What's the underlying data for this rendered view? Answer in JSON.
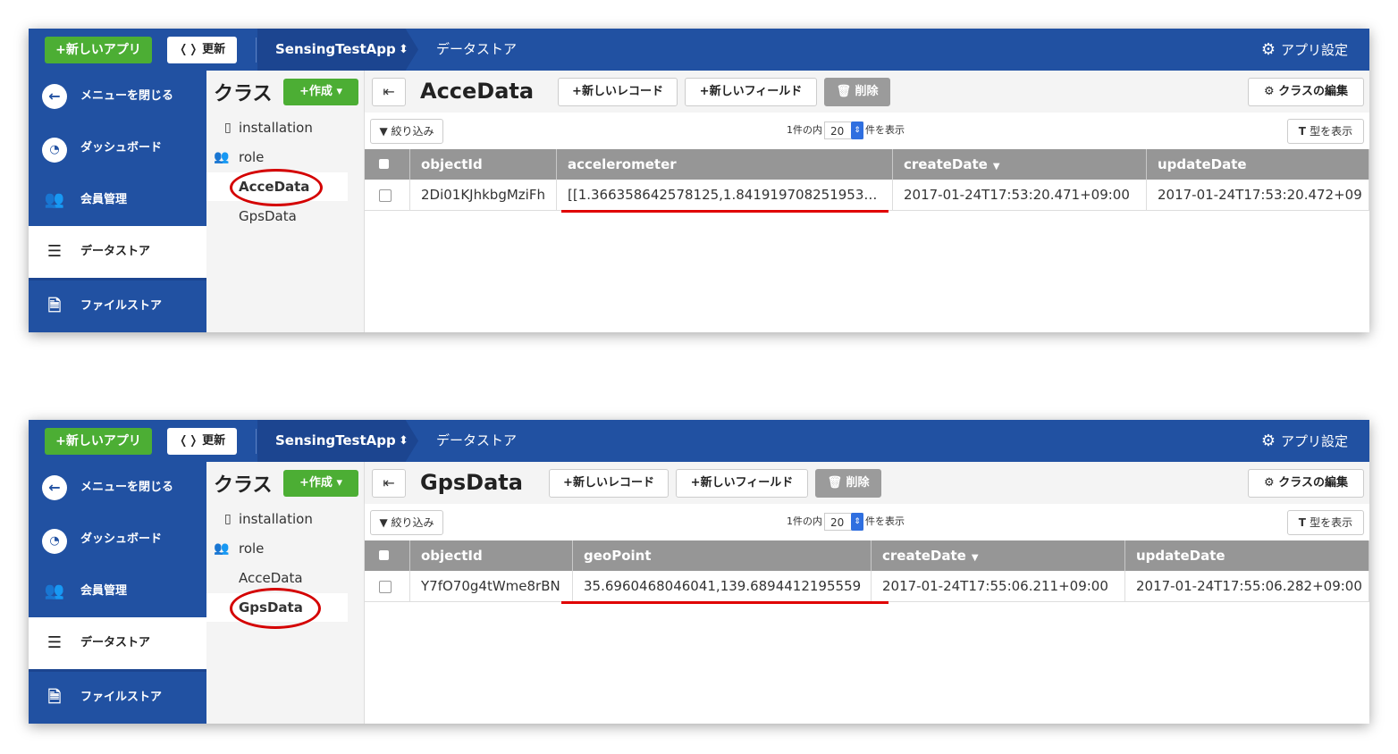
{
  "topbar": {
    "new_app_label": "+新しいアプリ",
    "refresh_label": "更新",
    "app_name": "SensingTestApp",
    "breadcrumb": "データストア",
    "settings_label": "アプリ設定"
  },
  "sidebar": {
    "items": [
      {
        "label": "メニューを閉じる",
        "icon": "arrow-left-icon"
      },
      {
        "label": "ダッシュボード",
        "icon": "gauge-icon"
      },
      {
        "label": "会員管理",
        "icon": "users-icon"
      },
      {
        "label": "データストア",
        "icon": "database-icon"
      },
      {
        "label": "ファイルストア",
        "icon": "file-code-icon"
      }
    ],
    "active_index": 3
  },
  "classes": {
    "title": "クラス",
    "create_label": "+作成",
    "items": [
      "installation",
      "role",
      "AcceData",
      "GpsData"
    ]
  },
  "toolbar": {
    "new_record": "+新しいレコード",
    "new_field": "+新しいフィールド",
    "delete": "削除",
    "edit_class": "クラスの編集",
    "filter": "絞り込み",
    "pager_prefix": "1件の内",
    "pager_value": "20",
    "pager_suffix": "件を表示",
    "show_types": "型を表示"
  },
  "screens": [
    {
      "class_name": "AcceData",
      "selected_class": "AcceData",
      "columns": [
        "objectId",
        "accelerometer",
        "createDate",
        "updateDate"
      ],
      "row": [
        "2Di01KJhkbgMziFh",
        "[[1.366358642578125,1.841919708251953…",
        "2017-01-24T17:53:20.471+09:00",
        "2017-01-24T17:53:20.472+09"
      ]
    },
    {
      "class_name": "GpsData",
      "selected_class": "GpsData",
      "columns": [
        "objectId",
        "geoPoint",
        "createDate",
        "updateDate"
      ],
      "row": [
        "Y7fO70g4tWme8rBN",
        "35.6960468046041,139.6894412195559",
        "2017-01-24T17:55:06.211+09:00",
        "2017-01-24T17:55:06.282+09:00"
      ]
    }
  ],
  "colors": {
    "nav_blue": "#2151a2",
    "green": "#4cae34",
    "header_gray": "#969696",
    "annotation_red": "#e00000"
  }
}
